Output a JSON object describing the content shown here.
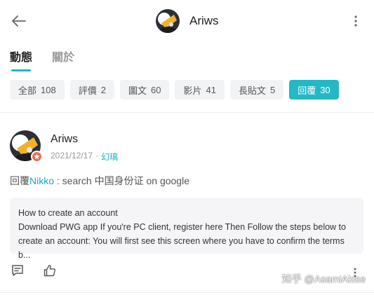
{
  "header": {
    "title": "Ariws",
    "back_icon": "arrow-left-icon",
    "more_icon": "vertical-dots-icon"
  },
  "tabs": [
    {
      "label": "動態",
      "active": true
    },
    {
      "label": "關於",
      "active": false
    }
  ],
  "filters": [
    {
      "label": "全部",
      "count": "108",
      "active": false
    },
    {
      "label": "評價",
      "count": "2",
      "active": false
    },
    {
      "label": "圖文",
      "count": "60",
      "active": false
    },
    {
      "label": "影片",
      "count": "41",
      "active": false
    },
    {
      "label": "長貼文",
      "count": "5",
      "active": false
    },
    {
      "label": "回覆",
      "count": "30",
      "active": true
    }
  ],
  "post": {
    "author": "Ariws",
    "date": "2021/12/17",
    "separator": "·",
    "subforum": "幻璃",
    "reply_prefix": "回覆",
    "mention": "Nikko",
    "reply_text": " : search 中国身份证 on google",
    "quote_title": "How to create an account",
    "quote_body": "Download PWG app If you're PC client, register here Then Follow the steps below to create an account: You will first see this screen where you have to confirm the terms b..."
  },
  "watermark": "知乎 @AsamiAkise",
  "colors": {
    "accent": "#23b8c5",
    "mention": "#1fa7c4",
    "badge": "#e8714a"
  }
}
